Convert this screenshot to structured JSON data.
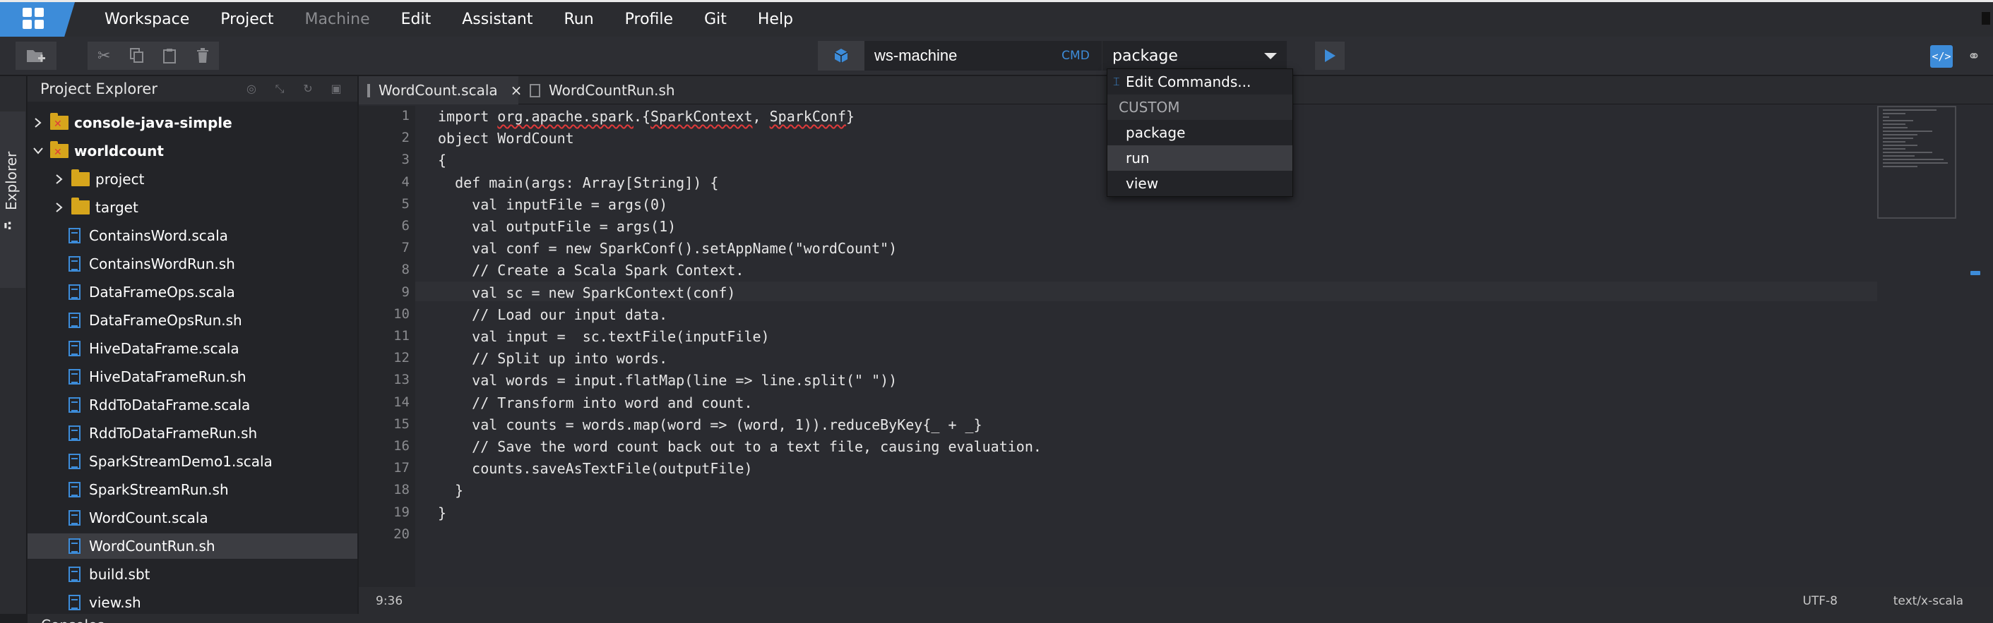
{
  "menubar": {
    "items": [
      {
        "label": "Workspace",
        "enabled": true
      },
      {
        "label": "Project",
        "enabled": true
      },
      {
        "label": "Machine",
        "enabled": false
      },
      {
        "label": "Edit",
        "enabled": true
      },
      {
        "label": "Assistant",
        "enabled": true
      },
      {
        "label": "Run",
        "enabled": true
      },
      {
        "label": "Profile",
        "enabled": true
      },
      {
        "label": "Git",
        "enabled": true
      },
      {
        "label": "Help",
        "enabled": true
      }
    ]
  },
  "toolbar": {
    "machine_value": "ws-machine",
    "cmd_label": "CMD",
    "cmd_selected": "package",
    "accent_color": "#3d8cd9"
  },
  "left_strip": {
    "explorer_tab_label": "Explorer"
  },
  "project_explorer": {
    "title": "Project Explorer",
    "tree": [
      {
        "label": "console-java-simple",
        "kind": "project",
        "expanded": false
      },
      {
        "label": "worldcount",
        "kind": "project",
        "expanded": true
      },
      {
        "label": "project",
        "kind": "folder",
        "expanded": false
      },
      {
        "label": "target",
        "kind": "folder",
        "expanded": false
      },
      {
        "label": "ContainsWord.scala",
        "kind": "file"
      },
      {
        "label": "ContainsWordRun.sh",
        "kind": "file"
      },
      {
        "label": "DataFrameOps.scala",
        "kind": "file"
      },
      {
        "label": "DataFrameOpsRun.sh",
        "kind": "file"
      },
      {
        "label": "HiveDataFrame.scala",
        "kind": "file"
      },
      {
        "label": "HiveDataFrameRun.sh",
        "kind": "file"
      },
      {
        "label": "RddToDataFrame.scala",
        "kind": "file"
      },
      {
        "label": "RddToDataFrameRun.sh",
        "kind": "file"
      },
      {
        "label": "SparkStreamDemo1.scala",
        "kind": "file"
      },
      {
        "label": "SparkStreamRun.sh",
        "kind": "file"
      },
      {
        "label": "WordCount.scala",
        "kind": "file"
      },
      {
        "label": "WordCountRun.sh",
        "kind": "file",
        "selected": true
      },
      {
        "label": "build.sbt",
        "kind": "file"
      },
      {
        "label": "view.sh",
        "kind": "file"
      }
    ]
  },
  "editor": {
    "tabs": [
      {
        "label": "WordCount.scala",
        "active": true,
        "close": "×"
      },
      {
        "label": "WordCountRun.sh",
        "active": false
      }
    ],
    "current_line": 9,
    "lines": [
      {
        "n": "1",
        "text": "import "
      },
      {
        "n": "2",
        "text": "object WordCount"
      },
      {
        "n": "3",
        "text": "{"
      },
      {
        "n": "4",
        "text": "  def main(args: Array[String]) {"
      },
      {
        "n": "5",
        "text": "    val inputFile = args(0)"
      },
      {
        "n": "6",
        "text": "    val outputFile = args(1)"
      },
      {
        "n": "7",
        "text": "    val conf = new SparkConf().setAppName(\"wordCount\")"
      },
      {
        "n": "8",
        "text": "    // Create a Scala Spark Context."
      },
      {
        "n": "9",
        "text": "    val sc = new SparkContext(conf)"
      },
      {
        "n": "10",
        "text": "    // Load our input data."
      },
      {
        "n": "11",
        "text": "    val input =  sc.textFile(inputFile)"
      },
      {
        "n": "12",
        "text": "    // Split up into words."
      },
      {
        "n": "13",
        "text": "    val words = input.flatMap(line => line.split(\" \"))"
      },
      {
        "n": "14",
        "text": "    // Transform into word and count."
      },
      {
        "n": "15",
        "text": "    val counts = words.map(word => (word, 1)).reduceByKey{_ + _}"
      },
      {
        "n": "16",
        "text": "    // Save the word count back out to a text file, causing evaluation."
      },
      {
        "n": "17",
        "text": "    counts.saveAsTextFile(outputFile)"
      },
      {
        "n": "18",
        "text": "  }"
      },
      {
        "n": "19",
        "text": "}"
      },
      {
        "n": "20",
        "text": ""
      }
    ],
    "line1_parts": {
      "pkg": "org.apache.spark",
      "dot_brace": ".{",
      "ctx": "SparkContext",
      "comma": ", ",
      "conf": "SparkConf",
      "close": "}"
    }
  },
  "status_bar": {
    "cursor": "9:36",
    "encoding": "UTF-8",
    "mime": "text/x-scala"
  },
  "bottom_panel": {
    "label": "Consoles"
  },
  "cmd_dropdown": {
    "edit_label": "Edit Commands...",
    "group_header": "CUSTOM",
    "options": [
      "package",
      "run",
      "view"
    ],
    "hovered": "run"
  }
}
